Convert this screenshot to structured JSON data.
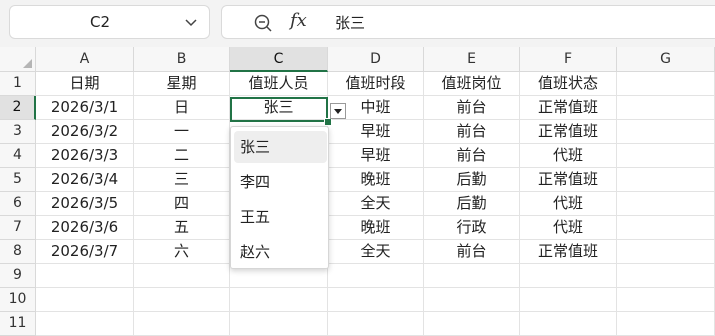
{
  "formula_bar": {
    "name_box": "C2",
    "zoom_icon": "zoom-icon",
    "fx_label": "fx",
    "formula": "张三"
  },
  "columns": [
    "A",
    "B",
    "C",
    "D",
    "E",
    "F",
    "G"
  ],
  "selected_column": "C",
  "selected_row": "2",
  "rows": [
    "1",
    "2",
    "3",
    "4",
    "5",
    "6",
    "7",
    "8",
    "9",
    "10",
    "11"
  ],
  "headers": [
    "日期",
    "星期",
    "值班人员",
    "值班时段",
    "值班岗位",
    "值班状态"
  ],
  "records": [
    [
      "2026/3/1",
      "日",
      "张三",
      "中班",
      "前台",
      "正常值班"
    ],
    [
      "2026/3/2",
      "一",
      "",
      "早班",
      "前台",
      "正常值班"
    ],
    [
      "2026/3/3",
      "二",
      "",
      "早班",
      "前台",
      "代班"
    ],
    [
      "2026/3/4",
      "三",
      "",
      "晚班",
      "后勤",
      "正常值班"
    ],
    [
      "2026/3/5",
      "四",
      "",
      "全天",
      "后勤",
      "代班"
    ],
    [
      "2026/3/6",
      "五",
      "",
      "晚班",
      "行政",
      "代班"
    ],
    [
      "2026/3/7",
      "六",
      "",
      "全天",
      "前台",
      "正常值班"
    ]
  ],
  "dropdown": {
    "options": [
      "张三",
      "李四",
      "王五",
      "赵六"
    ],
    "highlighted": "张三"
  },
  "colors": {
    "accent": "#217346",
    "header_bg": "#f7f7f7",
    "selected_header_bg": "#e1e1e1"
  }
}
